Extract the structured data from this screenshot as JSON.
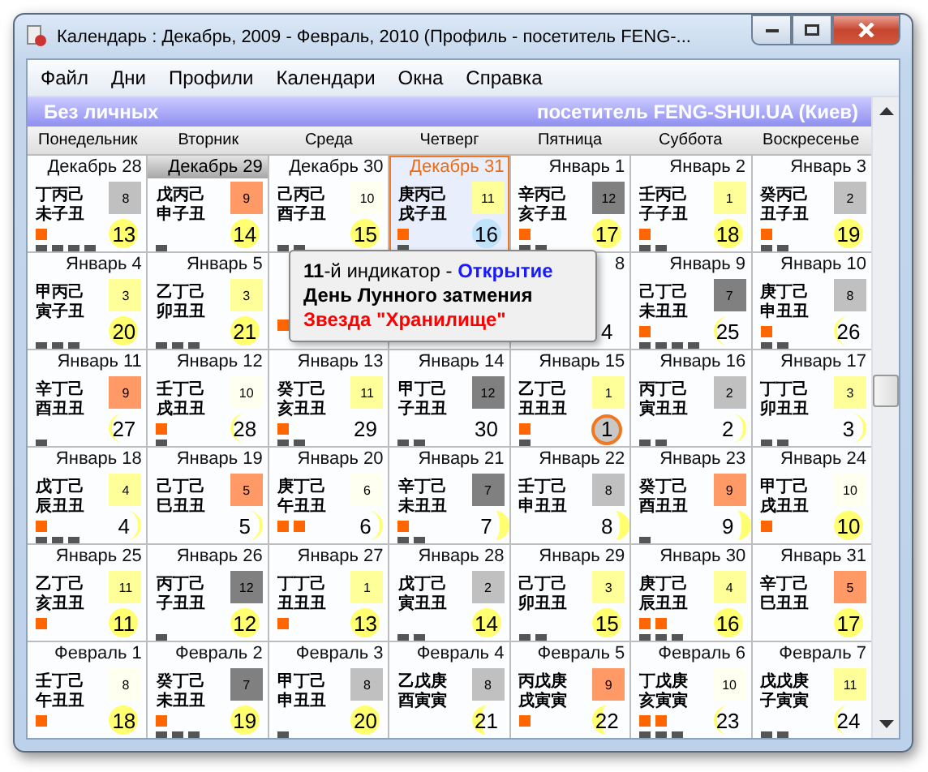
{
  "window": {
    "title": "Календарь : Декабрь, 2009 - Февраль, 2010 (Профиль - посетитель FENG-..."
  },
  "menu": [
    "Файл",
    "Дни",
    "Профили",
    "Календари",
    "Окна",
    "Справка"
  ],
  "header": {
    "left": "Без личных",
    "right": "посетитель FENG-SHUI.UA (Киев)"
  },
  "weekdays": [
    "Понедельник",
    "Вторник",
    "Среда",
    "Четверг",
    "Пятница",
    "Суббота",
    "Воскресенье"
  ],
  "cells": [
    {
      "selected": false,
      "today": false,
      "label": "Декабрь 28",
      "ganzhi": [
        "丁丙己",
        "未子丑"
      ],
      "star": {
        "number": "8",
        "color": "#c0c0c0"
      },
      "upper_marks": [
        {
          "color": "#ff6600"
        }
      ],
      "lower_marks": [
        {
          "color": "#555555"
        },
        {
          "color": "#555555"
        },
        {
          "color": "#555555"
        },
        {
          "color": "#555555"
        }
      ],
      "moon": {
        "kind": "full",
        "day": "13"
      }
    },
    {
      "selected": true,
      "today": false,
      "label": "Декабрь 29",
      "ganzhi": [
        "戊丙己",
        "申子丑"
      ],
      "star": {
        "number": "9",
        "color": "#ff9966"
      },
      "lower_marks": [
        {
          "color": "#555555"
        }
      ],
      "moon": {
        "kind": "full",
        "day": "14"
      }
    },
    {
      "selected": false,
      "today": false,
      "label": "Декабрь 30",
      "ganzhi": [
        "己丙己",
        "酉子丑"
      ],
      "star": {
        "number": "10",
        "color": "#fffff0"
      },
      "lower_marks": [
        {
          "color": "#555555"
        },
        {
          "color": "#555555"
        }
      ],
      "moon": {
        "kind": "full",
        "day": "15"
      }
    },
    {
      "selected": false,
      "today": true,
      "label": "Декабрь 31",
      "ganzhi": [
        "庚丙己",
        "戌子丑"
      ],
      "star": {
        "number": "11",
        "color": "#ffff99"
      },
      "upper_marks": [
        {
          "color": "#ff6600"
        }
      ],
      "lower_marks": [
        {
          "color": "#555555"
        }
      ],
      "moon": {
        "kind": "today",
        "day": "16"
      }
    },
    {
      "selected": false,
      "today": false,
      "label": "Январь 1",
      "ganzhi": [
        "辛丙己",
        "亥子丑"
      ],
      "star": {
        "number": "12",
        "color": "#808080"
      },
      "upper_marks": [
        {
          "color": "#ff6600"
        }
      ],
      "lower_marks": [
        {
          "color": "#555555"
        },
        {
          "color": "#555555"
        }
      ],
      "moon": {
        "kind": "full",
        "day": "17"
      }
    },
    {
      "selected": false,
      "today": false,
      "label": "Январь 2",
      "ganzhi": [
        "壬丙己",
        "子子丑"
      ],
      "star": {
        "number": "1",
        "color": "#ffff99"
      },
      "upper_marks": [
        {
          "color": "#ff6600"
        }
      ],
      "lower_marks": [
        {
          "color": "#555555"
        },
        {
          "color": "#555555"
        }
      ],
      "moon": {
        "kind": "full",
        "day": "18"
      }
    },
    {
      "selected": false,
      "today": false,
      "label": "Январь 3",
      "ganzhi": [
        "癸丙己",
        "丑子丑"
      ],
      "star": {
        "number": "2",
        "color": "#c0c0c0"
      },
      "upper_marks": [
        {
          "color": "#ff6600"
        }
      ],
      "lower_marks": [
        {
          "color": "#555555"
        },
        {
          "color": "#555555"
        }
      ],
      "moon": {
        "kind": "full",
        "day": "19"
      }
    },
    {
      "selected": false,
      "today": false,
      "label": "Январь 4",
      "ganzhi": [
        "甲丙己",
        "寅子丑"
      ],
      "star": {
        "number": "3",
        "color": "#ffff99"
      },
      "lower_marks": [
        {
          "color": "#555555"
        },
        {
          "color": "#555555"
        },
        {
          "color": "#555555"
        }
      ],
      "moon": {
        "kind": "full",
        "day": "20"
      }
    },
    {
      "selected": false,
      "today": false,
      "label": "Январь 5",
      "ganzhi": [
        "乙丁己",
        "卯丑丑"
      ],
      "star": {
        "number": "3",
        "color": "#ffff99"
      },
      "lower_marks": [
        {
          "color": "#555555"
        },
        {
          "color": "#555555"
        },
        {
          "color": "#555555"
        }
      ],
      "moon": {
        "kind": "full",
        "day": "21"
      }
    },
    {
      "today": false,
      "upper_marks": [
        {
          "color": "#ff6600"
        }
      ]
    },
    {
      "today": false
    },
    {
      "selected": false,
      "today": false,
      "label": "8",
      "moon": {
        "kind": "none",
        "day": "4"
      }
    },
    {
      "selected": false,
      "today": false,
      "label": "Январь 9",
      "ganzhi": [
        "己丁己",
        "未丑丑"
      ],
      "star": {
        "number": "7",
        "color": "#808080"
      },
      "upper_marks": [
        {
          "color": "#ff6600"
        }
      ],
      "lower_marks": [
        {
          "color": "#555555"
        },
        {
          "color": "#555555"
        },
        {
          "color": "#555555"
        },
        {
          "color": "#555555"
        }
      ],
      "moon": {
        "kind": "crescent-left",
        "day": "25"
      }
    },
    {
      "selected": false,
      "today": false,
      "label": "Январь 10",
      "ganzhi": [
        "庚丁己",
        "申丑丑"
      ],
      "star": {
        "number": "8",
        "color": "#c0c0c0"
      },
      "upper_marks": [
        {
          "color": "#ff6600"
        }
      ],
      "lower_marks": [
        {
          "color": "#555555"
        },
        {
          "color": "#555555"
        }
      ],
      "moon": {
        "kind": "crescent-left",
        "day": "26"
      }
    },
    {
      "selected": false,
      "today": false,
      "label": "Январь 11",
      "ganzhi": [
        "辛丁己",
        "酉丑丑"
      ],
      "star": {
        "number": "9",
        "color": "#ff9966"
      },
      "lower_marks": [
        {
          "color": "#555555"
        }
      ],
      "moon": {
        "kind": "crescent-left",
        "day": "27"
      }
    },
    {
      "selected": false,
      "today": false,
      "label": "Январь 12",
      "ganzhi": [
        "壬丁己",
        "戌丑丑"
      ],
      "star": {
        "number": "10",
        "color": "#fffff0"
      },
      "upper_marks": [
        {
          "color": "#ff6600"
        }
      ],
      "lower_marks": [
        {
          "color": "#555555"
        }
      ],
      "moon": {
        "kind": "crescent-left",
        "day": "28"
      }
    },
    {
      "selected": false,
      "today": false,
      "label": "Январь 13",
      "ganzhi": [
        "癸丁己",
        "亥丑丑"
      ],
      "star": {
        "number": "11",
        "color": "#ffff99"
      },
      "upper_marks": [
        {
          "color": "#ff6600"
        }
      ],
      "lower_marks": [
        {
          "color": "#555555"
        },
        {
          "color": "#555555"
        }
      ],
      "moon": {
        "kind": "none",
        "day": "29"
      }
    },
    {
      "selected": false,
      "today": false,
      "label": "Январь 14",
      "ganzhi": [
        "甲丁己",
        "子丑丑"
      ],
      "star": {
        "number": "12",
        "color": "#808080"
      },
      "lower_marks": [
        {
          "color": "#555555"
        },
        {
          "color": "#555555"
        }
      ],
      "moon": {
        "kind": "none",
        "day": "30"
      }
    },
    {
      "selected": false,
      "today": false,
      "label": "Январь 15",
      "ganzhi": [
        "乙丁己",
        "丑丑丑"
      ],
      "star": {
        "number": "1",
        "color": "#ffff99"
      },
      "upper_marks": [
        {
          "color": "#ff6600"
        }
      ],
      "lower_marks": [
        {
          "color": "#555555"
        }
      ],
      "moon": {
        "kind": "new",
        "day": "1"
      }
    },
    {
      "selected": false,
      "today": false,
      "label": "Январь 16",
      "ganzhi": [
        "丙丁己",
        "寅丑丑"
      ],
      "star": {
        "number": "2",
        "color": "#c0c0c0"
      },
      "lower_marks": [
        {
          "color": "#555555"
        },
        {
          "color": "#555555"
        }
      ],
      "moon": {
        "kind": "crescent-right",
        "day": "2"
      }
    },
    {
      "selected": false,
      "today": false,
      "label": "Январь 17",
      "ganzhi": [
        "丁丁己",
        "卯丑丑"
      ],
      "star": {
        "number": "3",
        "color": "#ffff99"
      },
      "lower_marks": [
        {
          "color": "#555555"
        },
        {
          "color": "#555555"
        }
      ],
      "moon": {
        "kind": "crescent-right",
        "day": "3"
      }
    },
    {
      "selected": false,
      "today": false,
      "label": "Январь 18",
      "ganzhi": [
        "戊丁己",
        "辰丑丑"
      ],
      "star": {
        "number": "4",
        "color": "#ffff99"
      },
      "upper_marks": [
        {
          "color": "#ff6600"
        }
      ],
      "lower_marks": [
        {
          "color": "#555555"
        },
        {
          "color": "#555555"
        },
        {
          "color": "#555555"
        }
      ],
      "moon": {
        "kind": "crescent-right",
        "day": "4"
      }
    },
    {
      "selected": false,
      "today": false,
      "label": "Январь 19",
      "ganzhi": [
        "己丁己",
        "巳丑丑"
      ],
      "star": {
        "number": "5",
        "color": "#ff9966"
      },
      "moon": {
        "kind": "crescent-right",
        "day": "5"
      }
    },
    {
      "selected": false,
      "today": false,
      "label": "Январь 20",
      "ganzhi": [
        "庚丁己",
        "午丑丑"
      ],
      "star": {
        "number": "6",
        "color": "#fffff0"
      },
      "upper_marks": [
        {
          "color": "#ff6600"
        },
        {
          "color": "#ff6600"
        }
      ],
      "moon": {
        "kind": "crescent-right",
        "day": "6"
      }
    },
    {
      "selected": false,
      "today": false,
      "label": "Январь 21",
      "ganzhi": [
        "辛丁己",
        "未丑丑"
      ],
      "star": {
        "number": "7",
        "color": "#808080"
      },
      "upper_marks": [
        {
          "color": "#ff6600"
        }
      ],
      "lower_marks": [
        {
          "color": "#555555"
        },
        {
          "color": "#555555"
        }
      ],
      "moon": {
        "kind": "half-right",
        "day": "7"
      }
    },
    {
      "selected": false,
      "today": false,
      "label": "Январь 22",
      "ganzhi": [
        "壬丁己",
        "申丑丑"
      ],
      "star": {
        "number": "8",
        "color": "#c0c0c0"
      },
      "moon": {
        "kind": "half-right",
        "day": "8"
      }
    },
    {
      "selected": false,
      "today": false,
      "label": "Январь 23",
      "ganzhi": [
        "癸丁己",
        "酉丑丑"
      ],
      "star": {
        "number": "9",
        "color": "#ff9966"
      },
      "lower_marks": [
        {
          "color": "#555555"
        }
      ],
      "moon": {
        "kind": "half-right",
        "day": "9"
      }
    },
    {
      "selected": false,
      "today": false,
      "label": "Январь 24",
      "ganzhi": [
        "甲丁己",
        "戌丑丑"
      ],
      "star": {
        "number": "10",
        "color": "#fffff0"
      },
      "upper_marks": [
        {
          "color": "#ff6600"
        }
      ],
      "moon": {
        "kind": "full",
        "day": "10"
      }
    },
    {
      "selected": false,
      "today": false,
      "label": "Январь 25",
      "ganzhi": [
        "乙丁己",
        "亥丑丑"
      ],
      "star": {
        "number": "11",
        "color": "#ffff99"
      },
      "upper_marks": [
        {
          "color": "#ff6600"
        }
      ],
      "moon": {
        "kind": "full",
        "day": "11"
      }
    },
    {
      "selected": false,
      "today": false,
      "label": "Январь 26",
      "ganzhi": [
        "丙丁己",
        "子丑丑"
      ],
      "star": {
        "number": "12",
        "color": "#808080"
      },
      "lower_marks": [
        {
          "color": "#555555"
        }
      ],
      "moon": {
        "kind": "full",
        "day": "12"
      }
    },
    {
      "selected": false,
      "today": false,
      "label": "Январь 27",
      "ganzhi": [
        "丁丁己",
        "丑丑丑"
      ],
      "star": {
        "number": "1",
        "color": "#ffff99"
      },
      "upper_marks": [
        {
          "color": "#ff6600"
        }
      ],
      "moon": {
        "kind": "full",
        "day": "13"
      }
    },
    {
      "selected": false,
      "today": false,
      "label": "Январь 28",
      "ganzhi": [
        "戊丁己",
        "寅丑丑"
      ],
      "star": {
        "number": "2",
        "color": "#c0c0c0"
      },
      "lower_marks": [
        {
          "color": "#555555"
        },
        {
          "color": "#555555"
        }
      ],
      "moon": {
        "kind": "full",
        "day": "14"
      }
    },
    {
      "selected": false,
      "today": false,
      "label": "Январь 29",
      "ganzhi": [
        "己丁己",
        "卯丑丑"
      ],
      "star": {
        "number": "3",
        "color": "#ffff99"
      },
      "lower_marks": [
        {
          "color": "#555555"
        },
        {
          "color": "#555555"
        }
      ],
      "moon": {
        "kind": "full",
        "day": "15"
      }
    },
    {
      "selected": false,
      "today": false,
      "label": "Январь 30",
      "ganzhi": [
        "庚丁己",
        "辰丑丑"
      ],
      "star": {
        "number": "4",
        "color": "#ffff99"
      },
      "upper_marks": [
        {
          "color": "#ff6600"
        },
        {
          "color": "#ff6600"
        }
      ],
      "lower_marks": [
        {
          "color": "#555555"
        },
        {
          "color": "#555555"
        },
        {
          "color": "#555555"
        }
      ],
      "moon": {
        "kind": "full",
        "day": "16"
      }
    },
    {
      "selected": false,
      "today": false,
      "label": "Январь 31",
      "ganzhi": [
        "辛丁己",
        "巳丑丑"
      ],
      "star": {
        "number": "5",
        "color": "#ff9966"
      },
      "moon": {
        "kind": "full",
        "day": "17"
      }
    },
    {
      "selected": false,
      "today": false,
      "label": "Февраль 1",
      "ganzhi": [
        "壬丁己",
        "午丑丑"
      ],
      "star": {
        "number": "8",
        "color": "#fffff0"
      },
      "upper_marks": [
        {
          "color": "#ff6600"
        }
      ],
      "moon": {
        "kind": "full",
        "day": "18"
      }
    },
    {
      "selected": false,
      "today": false,
      "label": "Февраль 2",
      "ganzhi": [
        "癸丁己",
        "未丑丑"
      ],
      "star": {
        "number": "7",
        "color": "#808080"
      },
      "upper_marks": [
        {
          "color": "#ff6600"
        }
      ],
      "lower_marks": [
        {
          "color": "#555555"
        },
        {
          "color": "#555555"
        },
        {
          "color": "#555555"
        }
      ],
      "moon": {
        "kind": "full",
        "day": "19"
      }
    },
    {
      "selected": false,
      "today": false,
      "label": "Февраль 3",
      "ganzhi": [
        "甲丁己",
        "申丑丑"
      ],
      "star": {
        "number": "8",
        "color": "#c0c0c0"
      },
      "lower_marks": [
        {
          "color": "#555555"
        }
      ],
      "moon": {
        "kind": "full",
        "day": "20"
      }
    },
    {
      "selected": false,
      "today": false,
      "label": "Февраль 4",
      "ganzhi": [
        "乙戊庚",
        "酉寅寅"
      ],
      "star": {
        "number": "8",
        "color": "#c0c0c0"
      },
      "moon": {
        "kind": "half-left",
        "day": "21"
      }
    },
    {
      "selected": false,
      "today": false,
      "label": "Февраль 5",
      "ganzhi": [
        "丙戊庚",
        "戌寅寅"
      ],
      "star": {
        "number": "9",
        "color": "#ff9966"
      },
      "upper_marks": [
        {
          "color": "#ff6600"
        }
      ],
      "moon": {
        "kind": "half-left",
        "day": "22"
      }
    },
    {
      "selected": false,
      "today": false,
      "label": "Февраль 6",
      "ganzhi": [
        "丁戊庚",
        "亥寅寅"
      ],
      "star": {
        "number": "10",
        "color": "#fffff0"
      },
      "upper_marks": [
        {
          "color": "#ff6600"
        },
        {
          "color": "#ff6600"
        }
      ],
      "lower_marks": [
        {
          "color": "#555555"
        },
        {
          "color": "#555555"
        },
        {
          "color": "#555555"
        }
      ],
      "moon": {
        "kind": "crescent-left",
        "day": "23"
      }
    },
    {
      "selected": false,
      "today": false,
      "label": "Февраль 7",
      "ganzhi": [
        "戊戊庚",
        "子寅寅"
      ],
      "star": {
        "number": "11",
        "color": "#ffff99"
      },
      "lower_marks": [
        {
          "color": "#555555"
        },
        {
          "color": "#555555"
        }
      ],
      "moon": {
        "kind": "crescent-left",
        "day": "24"
      }
    }
  ],
  "tooltip": {
    "number": "11",
    "indicator": "-й индикатор - ",
    "name": "Открытие",
    "event": "День Лунного затмения",
    "star": "Звезда \"Хранилище\""
  }
}
